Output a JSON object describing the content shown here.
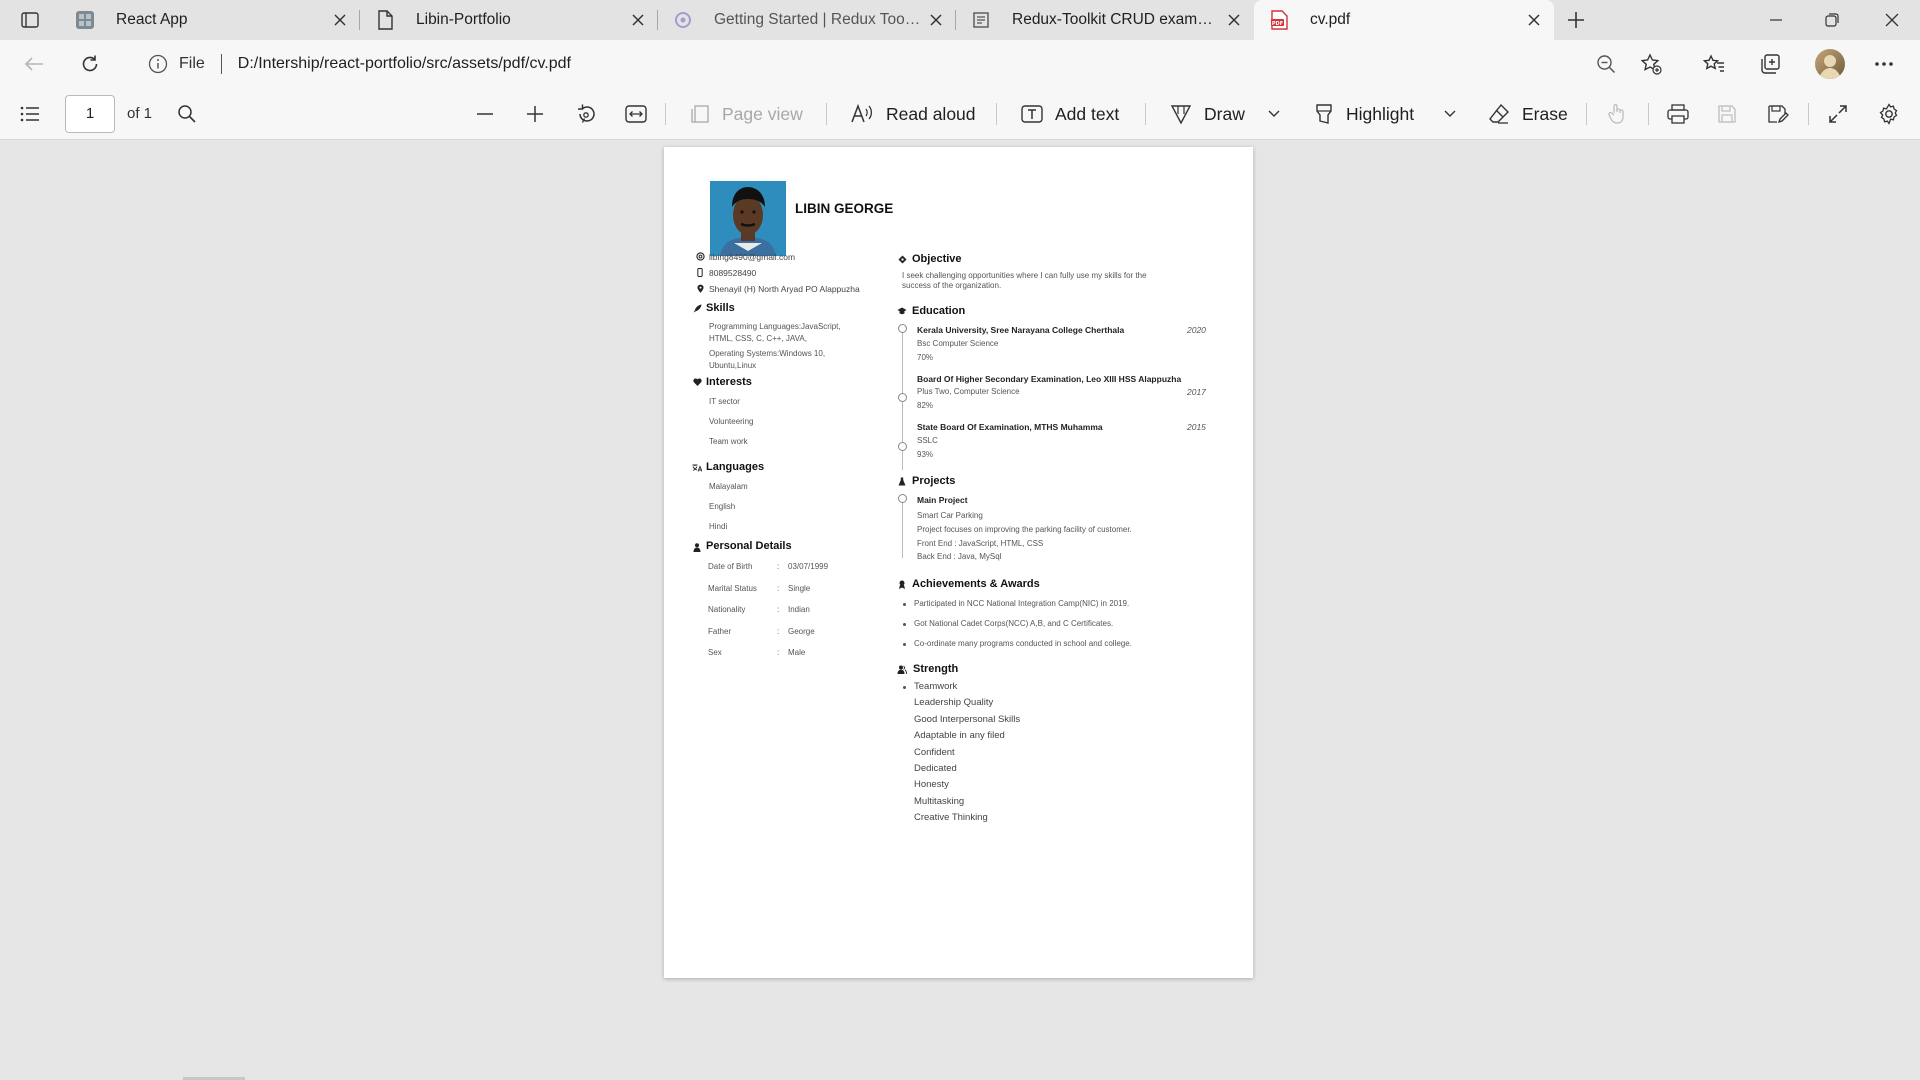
{
  "browser": {
    "tabs": [
      {
        "title": "React App",
        "active": false
      },
      {
        "title": "Libin-Portfolio",
        "active": false
      },
      {
        "title": "Getting Started | Redux Toolkit",
        "active": false
      },
      {
        "title": "Redux-Toolkit CRUD example with",
        "active": false
      },
      {
        "title": "cv.pdf",
        "active": true
      }
    ],
    "address": {
      "scheme_label": "File",
      "url": "D:/Intership/react-portfolio/src/assets/pdf/cv.pdf"
    }
  },
  "pdf_toolbar": {
    "page_number": "1",
    "page_count": "of 1",
    "page_view": "Page view",
    "read_aloud": "Read aloud",
    "add_text": "Add text",
    "draw": "Draw",
    "highlight": "Highlight",
    "erase": "Erase"
  },
  "cv": {
    "name": "LIBIN GEORGE",
    "contact": {
      "email": "libing8490@gmail.com",
      "phone": "8089528490",
      "address": "Shenayil (H) North Aryad PO Alappuzha"
    },
    "skills": {
      "title": "Skills",
      "items": [
        {
          "line1": "Programming Languages:JavaScript,",
          "line2": "HTML, CSS, C, C++, JAVA,"
        },
        {
          "line1": "Operating Systems:Windows 10,",
          "line2": "Ubuntu,Linux"
        }
      ]
    },
    "interests": {
      "title": "Interests",
      "items": [
        "IT sector",
        "Volunteering",
        "Team work"
      ]
    },
    "languages": {
      "title": "Languages",
      "items": [
        "Malayalam",
        "English",
        "Hindi"
      ]
    },
    "personal": {
      "title": "Personal Details",
      "rows": [
        {
          "label": "Date of Birth",
          "sep": ":",
          "value": "03/07/1999"
        },
        {
          "label": "Marital Status",
          "sep": ":",
          "value": "Single"
        },
        {
          "label": "Nationality",
          "sep": ":",
          "value": "Indian"
        },
        {
          "label": "Father",
          "sep": ":",
          "value": "George"
        },
        {
          "label": "Sex",
          "sep": ":",
          "value": "Male"
        }
      ]
    },
    "objective": {
      "title": "Objective",
      "line1": "I seek challenging opportunities where I can fully use my skills for the",
      "line2": "success of the organization."
    },
    "education": {
      "title": "Education",
      "items": [
        {
          "institution": "Kerala University, Sree Narayana College Cherthala",
          "course": "Bsc Computer Science",
          "score": "70%",
          "year": "2020"
        },
        {
          "institution": "Board Of Higher Secondary Examination, Leo XIII HSS Alappuzha",
          "course": "Plus Two, Computer Science",
          "score": "82%",
          "year": "2017"
        },
        {
          "institution": "State Board Of Examination, MTHS Muhamma",
          "course": "SSLC",
          "score": "93%",
          "year": "2015"
        }
      ]
    },
    "projects": {
      "title": "Projects",
      "heading": "Main Project",
      "lines": [
        "Smart Car Parking",
        "Project focuses on improving the parking facility of customer.",
        "Front End : JavaScript, HTML, CSS",
        "Back End : Java, MySql"
      ]
    },
    "achievements": {
      "title": "Achievements & Awards",
      "items": [
        "Participated in NCC National Integration Camp(NIC) in 2019.",
        "Got National Cadet Corps(NCC) A,B, and C Certificates.",
        "Co-ordinate many programs conducted in school and college."
      ]
    },
    "strength": {
      "title": "Strength",
      "items": [
        "Teamwork",
        "Leadership Quality",
        "Good Interpersonal Skills",
        "Adaptable in any filed",
        "Confident",
        "Dedicated",
        "Honesty",
        "Multitasking",
        "Creative Thinking"
      ]
    }
  }
}
